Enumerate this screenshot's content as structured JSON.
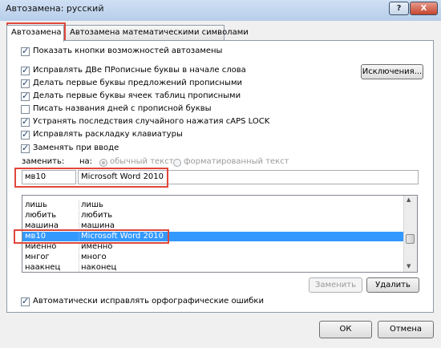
{
  "window": {
    "title": "Автозамена: русский"
  },
  "titlebar_buttons": {
    "help": "?",
    "close": "X"
  },
  "tabs": [
    {
      "label": "Автозамена",
      "active": true
    },
    {
      "label": "Автозамена математическими символами",
      "active": false
    }
  ],
  "options": {
    "show_buttons": {
      "label": "Показать кнопки возможностей автозамены",
      "checked": true
    },
    "rules": [
      {
        "label": "Исправлять ДВе ПРописные буквы в начале слова",
        "checked": true
      },
      {
        "label": "Делать первые буквы предложений прописными",
        "checked": true
      },
      {
        "label": "Делать первые буквы ячеек таблиц прописными",
        "checked": true
      },
      {
        "label": "Писать названия дней с прописной буквы",
        "checked": false
      },
      {
        "label": "Устранять последствия случайного нажатия cAPS LOCK",
        "checked": true
      },
      {
        "label": "Исправлять раскладку клавиатуры",
        "checked": true
      },
      {
        "label": "Заменять при вводе",
        "checked": true
      }
    ],
    "exceptions_button": "Исключения..."
  },
  "replace": {
    "replace_label": "заменить:",
    "with_label": "на:",
    "plain_text": "обычный текст",
    "formatted_text": "форматированный текст",
    "replace_value": "мв10",
    "with_value": "Microsoft Word 2010"
  },
  "entries": [
    {
      "replace": "лишь",
      "with": "лишь"
    },
    {
      "replace": "любить",
      "with": "любить"
    },
    {
      "replace": "машина",
      "with": "машина"
    },
    {
      "replace": "мв10",
      "with": "Microsoft Word 2010",
      "selected": true
    },
    {
      "replace": "миенно",
      "with": "именно"
    },
    {
      "replace": "мнгог",
      "with": "много"
    },
    {
      "replace": "наакнец",
      "with": "наконец"
    }
  ],
  "actions": {
    "replace_button": "Заменить",
    "delete_button": "Удалить"
  },
  "spelling": {
    "label": "Автоматически исправлять орфографические ошибки",
    "checked": true
  },
  "footer": {
    "ok": "ОК",
    "cancel": "Отмена"
  },
  "colors": {
    "selection": "#3399ff",
    "highlight_frame": "#e0473b"
  }
}
